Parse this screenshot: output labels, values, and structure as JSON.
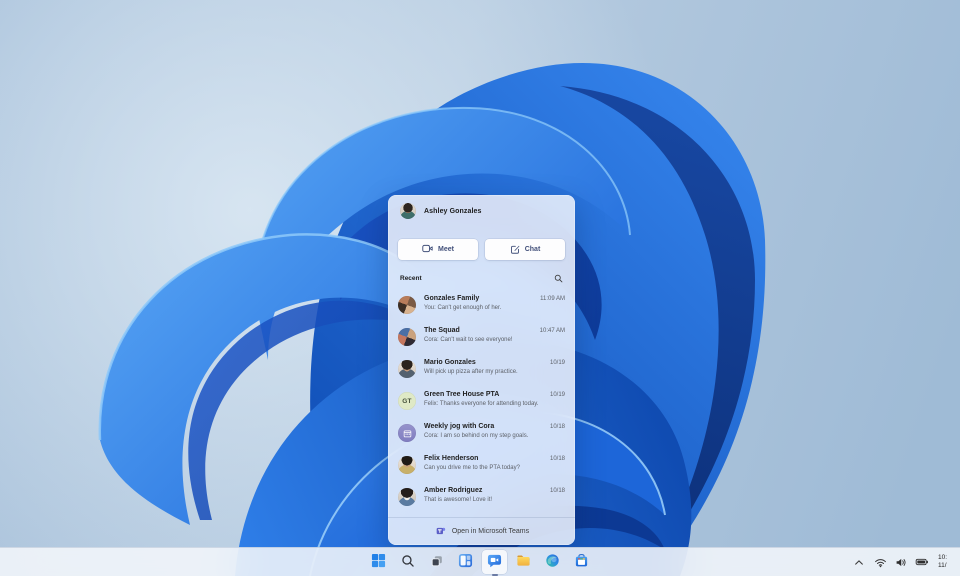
{
  "desktop": {
    "wallpaper_name": "windows-11-bloom",
    "colors": {
      "background_sky": "#aec7de",
      "bloom_bright": "#3b8ef2",
      "bloom_dark": "#0b3690",
      "accent_blue": "#2b7de9",
      "teams_purple": "#5b5fc7"
    }
  },
  "chat_flyout": {
    "user": {
      "name": "Ashley Gonzales",
      "avatar": "ashley-photo-avatar"
    },
    "actions": {
      "meet": {
        "label": "Meet",
        "icon": "video-camera-icon"
      },
      "chat": {
        "label": "Chat",
        "icon": "compose-icon"
      }
    },
    "recent_label": "Recent",
    "search_icon": "search-icon",
    "conversations": [
      {
        "name": "Gonzales Family",
        "preview": "You: Can't get enough of her.",
        "time": "11:09 AM",
        "avatar": "group-photo-collage"
      },
      {
        "name": "The Squad",
        "preview": "Cora: Can't wait to see everyone!",
        "time": "10:47 AM",
        "avatar": "group-photo-collage"
      },
      {
        "name": "Mario Gonzales",
        "preview": "Will pick up pizza after my practice.",
        "time": "10/19",
        "avatar": "photo"
      },
      {
        "name": "Green Tree House PTA",
        "preview": "Felix: Thanks everyone for attending today.",
        "time": "10/19",
        "avatar": "initials",
        "initials": "GT"
      },
      {
        "name": "Weekly jog with Cora",
        "preview": "Cora: I am so behind on my step goals.",
        "time": "10/18",
        "avatar": "calendar-icon"
      },
      {
        "name": "Felix Henderson",
        "preview": "Can you drive me to the PTA today?",
        "time": "10/18",
        "avatar": "photo"
      },
      {
        "name": "Amber Rodriguez",
        "preview": "That is awesome! Love it!",
        "time": "10/18",
        "avatar": "photo"
      }
    ],
    "footer": {
      "label": "Open in Microsoft Teams",
      "icon": "teams-icon"
    }
  },
  "taskbar": {
    "buttons": [
      {
        "icon": "start-icon",
        "active": false
      },
      {
        "icon": "search-icon",
        "active": false
      },
      {
        "icon": "task-view-icon",
        "active": false
      },
      {
        "icon": "widgets-icon",
        "active": false
      },
      {
        "icon": "chat-icon",
        "active": true
      },
      {
        "icon": "file-explorer-icon",
        "active": false
      },
      {
        "icon": "edge-icon",
        "active": false
      },
      {
        "icon": "store-icon",
        "active": false
      }
    ],
    "tray": {
      "icons": [
        "chevron-up-icon",
        "wifi-icon",
        "volume-icon",
        "battery-icon"
      ],
      "clock": {
        "time": "10:",
        "date": "11/"
      }
    }
  }
}
